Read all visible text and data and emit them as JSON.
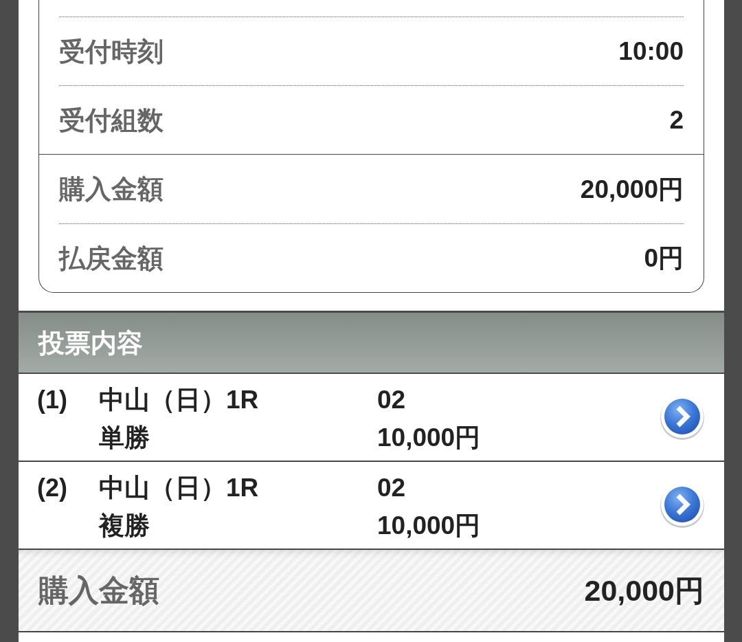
{
  "receipt_card": {
    "sections": [
      {
        "rows": [
          {
            "label": "受付時刻",
            "value": "10:00"
          },
          {
            "label": "受付組数",
            "value": "2"
          }
        ]
      },
      {
        "rows": [
          {
            "label": "購入金額",
            "value": "20,000円"
          },
          {
            "label": "払戻金額",
            "value": "0円"
          }
        ]
      }
    ]
  },
  "bet_section": {
    "title": "投票内容",
    "bets": [
      {
        "index": "(1)",
        "race": "中山（日）1R",
        "bet_type": "単勝",
        "selection": "02",
        "amount": "10,000円"
      },
      {
        "index": "(2)",
        "race": "中山（日）1R",
        "bet_type": "複勝",
        "selection": "02",
        "amount": "10,000円"
      }
    ]
  },
  "total": {
    "label": "購入金額",
    "value": "20,000円"
  }
}
